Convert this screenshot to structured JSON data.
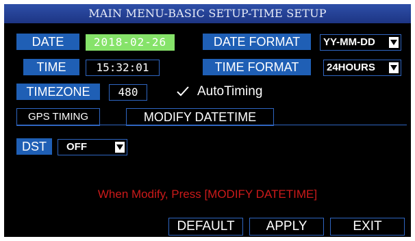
{
  "title": "MAIN MENU-BASIC SETUP-TIME SETUP",
  "date": {
    "label": "DATE",
    "value": "2018-02-26"
  },
  "date_format": {
    "label": "DATE FORMAT",
    "value": "YY-MM-DD"
  },
  "time": {
    "label": "TIME",
    "value": "15:32:01"
  },
  "time_format": {
    "label": "TIME FORMAT",
    "value": "24HOURS"
  },
  "timezone": {
    "label": "TIMEZONE",
    "value": "480"
  },
  "auto_timing": {
    "label": "AutoTiming",
    "checked": true
  },
  "buttons": {
    "gps_timing": "GPS TIMING",
    "modify_datetime": "MODIFY DATETIME",
    "default": "DEFAULT",
    "apply": "APPLY",
    "exit": "EXIT"
  },
  "dst": {
    "label": "DST",
    "value": "OFF"
  },
  "note": "When Modify, Press [MODIFY DATETIME]",
  "colors": {
    "label_bg": "#1f5fb5",
    "highlight": "#86e36a",
    "warning": "#cc1a1a",
    "title_bg": "#2446a0"
  },
  "icons": {
    "dropdown": "dropdown-arrow-icon",
    "check": "checkmark-icon"
  }
}
